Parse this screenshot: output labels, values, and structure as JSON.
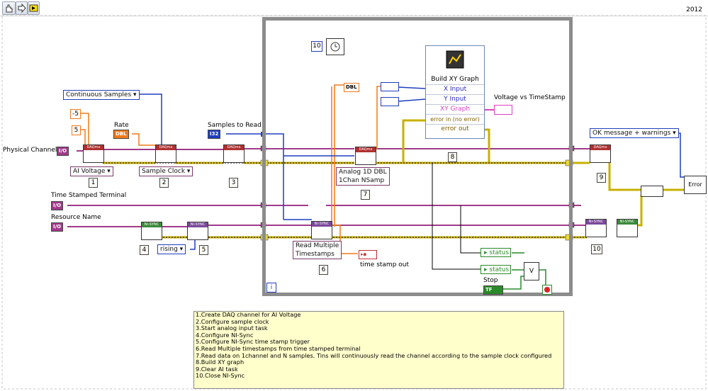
{
  "toolbar": {
    "year": "2012"
  },
  "labels": {
    "physical_channel": "Physical Channel",
    "rate": "Rate",
    "samples_to_read": "Samples to Read",
    "time_stamped_terminal": "Time Stamped Terminal",
    "resource_name": "Resource Name",
    "stop": "Stop",
    "time_stamp_out": "time stamp out",
    "voltage_vs_timestamp": "Voltage vs TimeStamp"
  },
  "constants": {
    "minus5": "-5",
    "plus5": "5",
    "wait_ms": "10"
  },
  "controls": {
    "continuous_samples": "Continuous Samples",
    "ai_voltage": "AI Voltage",
    "sample_clock": "Sample Clock",
    "analog_line1": "Analog 1D DBL",
    "analog_line2": "1Chan NSamp",
    "read_multiple_line1": "Read Multiple",
    "read_multiple_line2": "Timestamps",
    "rising": "rising",
    "ok_message": "OK message + warnings"
  },
  "xy_graph": {
    "title": "Build XY Graph",
    "rows": [
      "X Input",
      "Y Input",
      "XY Graph",
      "error in (no error)",
      "error out"
    ]
  },
  "terminals": {
    "status": "status",
    "status2": "status",
    "error": "Error"
  },
  "numbers": [
    "1",
    "2",
    "3",
    "4",
    "5",
    "6",
    "7",
    "8",
    "9",
    "10"
  ],
  "notes": [
    "1.Create DAQ channel for AI Voltage",
    "2.Configure sample clock",
    "3.Start analog input task",
    "4.Configure NI-Sync",
    "5.Configure NI-Sync time stamp trigger",
    "6.Read Multiple timestamps from time stamped terminal",
    "7.Read data on 1channel and N samples. Tins will continuously read the channel according to the sample clock configured",
    "8.Build XY graph",
    "9.Clear AI task",
    "10.Close NI-Sync"
  ],
  "loop_index": "i",
  "colors": {
    "error_wire": "#c8b000",
    "task_wire": "#a03a8a",
    "dbl_wire": "#f07a1a",
    "i32_wire": "#1f3fbf",
    "loop_border": "#8c8c8c",
    "stop_wire": "#2a8a2a"
  }
}
